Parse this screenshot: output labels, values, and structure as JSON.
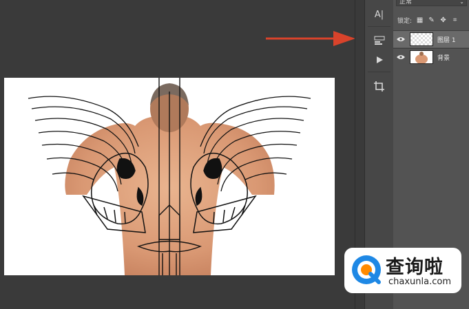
{
  "layers_panel": {
    "blend_mode": "正常",
    "lock_label": "锁定:",
    "layers": [
      {
        "name": "图层 1",
        "selected": true,
        "thumbnail": "skull-wings-thumbnail"
      },
      {
        "name": "背景",
        "selected": false,
        "thumbnail": "man-back-thumbnail"
      }
    ]
  },
  "toolbar": {
    "tools": [
      "type-icon",
      "properties-icon",
      "play-icon",
      "crop-icon"
    ]
  },
  "watermark": {
    "chinese": "查询啦",
    "url": "chaxunla.com"
  },
  "colors": {
    "accent_red": "#d9432b",
    "watermark_blue": "#1e88e5",
    "watermark_orange": "#ff8a00"
  }
}
